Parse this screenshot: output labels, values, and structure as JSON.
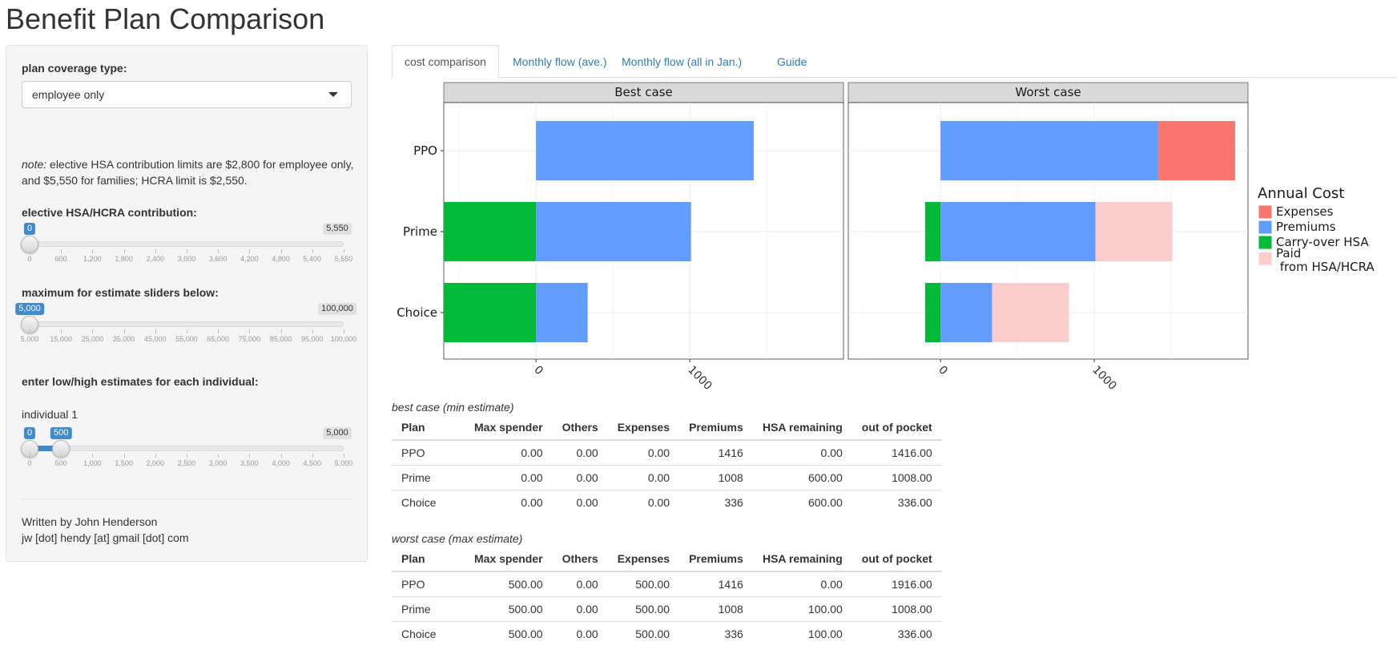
{
  "page_title": "Benefit Plan Comparison",
  "sidebar": {
    "coverage_label": "plan coverage type:",
    "coverage_value": "employee only",
    "note_prefix": "note:",
    "note_text": " elective HSA contribution limits are $2,800 for employee only, and $5,550 for families; HCRA limit is $2,550.",
    "hsa_label": "elective HSA/HCRA contribution:",
    "hsa_slider": {
      "value": "0",
      "max": "5,550",
      "fraction": 0,
      "ticks": [
        "0",
        "600",
        "1,200",
        "1,800",
        "2,400",
        "3,000",
        "3,600",
        "4,200",
        "4,800",
        "5,400",
        "5,550"
      ]
    },
    "max_label": "maximum for estimate sliders below:",
    "max_slider": {
      "value": "5,000",
      "max": "100,000",
      "fraction": 0,
      "ticks": [
        "5,000",
        "15,000",
        "25,000",
        "35,000",
        "45,000",
        "55,000",
        "65,000",
        "75,000",
        "85,000",
        "95,000",
        "100,000"
      ]
    },
    "estimates_label": "enter low/high estimates for each individual:",
    "individual_label": "individual 1",
    "ind_slider": {
      "low": "0",
      "high": "500",
      "max": "5,000",
      "low_fraction": 0,
      "high_fraction": 0.1,
      "ticks": [
        "0",
        "500",
        "1,000",
        "1,500",
        "2,000",
        "2,500",
        "3,000",
        "3,500",
        "4,000",
        "4,500",
        "5,000"
      ]
    },
    "author": "Written by John Henderson",
    "email": "jw [dot] hendy [at] gmail [dot] com"
  },
  "tabs": [
    {
      "label": "cost comparison",
      "active": true
    },
    {
      "label": "Monthly flow (ave.)",
      "active": false
    },
    {
      "label": "Monthly flow (all in Jan.)",
      "active": false
    },
    {
      "label": "Guide",
      "active": false
    }
  ],
  "colors": {
    "expenses": "#F8766D",
    "premiums": "#619CFF",
    "carryover": "#00BA38",
    "paid": "#FCCDCD"
  },
  "chart_data": {
    "type": "bar",
    "orientation": "horizontal",
    "stacked": true,
    "categories": [
      "PPO",
      "Prime",
      "Choice"
    ],
    "x_ticks": [
      "0",
      "1000"
    ],
    "xlim": [
      -600,
      2000
    ],
    "grid": true,
    "legend_title": "Annual Cost",
    "legend_position": "right",
    "legend": [
      "Expenses",
      "Premiums",
      "Carry-over HSA",
      "Paid\n from HSA/HCRA"
    ],
    "panels": [
      {
        "title": "Best case",
        "series": [
          {
            "name": "Carry-over HSA",
            "values": [
              0,
              -600,
              -600
            ]
          },
          {
            "name": "Premiums",
            "values": [
              1416,
              1008,
              336
            ]
          },
          {
            "name": "Paid\n from HSA/HCRA",
            "values": [
              0,
              0,
              0
            ]
          },
          {
            "name": "Expenses",
            "values": [
              0,
              0,
              0
            ]
          }
        ]
      },
      {
        "title": "Worst case",
        "series": [
          {
            "name": "Carry-over HSA",
            "values": [
              0,
              -100,
              -100
            ]
          },
          {
            "name": "Premiums",
            "values": [
              1416,
              1008,
              336
            ]
          },
          {
            "name": "Paid\n from HSA/HCRA",
            "values": [
              0,
              500,
              500
            ]
          },
          {
            "name": "Expenses",
            "values": [
              500,
              0,
              0
            ]
          }
        ]
      }
    ]
  },
  "best_table": {
    "caption": "best case (min estimate)",
    "headers": [
      "Plan",
      "Max spender",
      "Others",
      "Expenses",
      "Premiums",
      "HSA remaining",
      "out of pocket"
    ],
    "rows": [
      [
        "PPO",
        "0.00",
        "0.00",
        "0.00",
        "1416",
        "0.00",
        "1416.00"
      ],
      [
        "Prime",
        "0.00",
        "0.00",
        "0.00",
        "1008",
        "600.00",
        "1008.00"
      ],
      [
        "Choice",
        "0.00",
        "0.00",
        "0.00",
        "336",
        "600.00",
        "336.00"
      ]
    ]
  },
  "worst_table": {
    "caption": "worst case (max estimate)",
    "headers": [
      "Plan",
      "Max spender",
      "Others",
      "Expenses",
      "Premiums",
      "HSA remaining",
      "out of pocket"
    ],
    "rows": [
      [
        "PPO",
        "500.00",
        "0.00",
        "500.00",
        "1416",
        "0.00",
        "1916.00"
      ],
      [
        "Prime",
        "500.00",
        "0.00",
        "500.00",
        "1008",
        "100.00",
        "1008.00"
      ],
      [
        "Choice",
        "500.00",
        "0.00",
        "500.00",
        "336",
        "100.00",
        "336.00"
      ]
    ]
  }
}
